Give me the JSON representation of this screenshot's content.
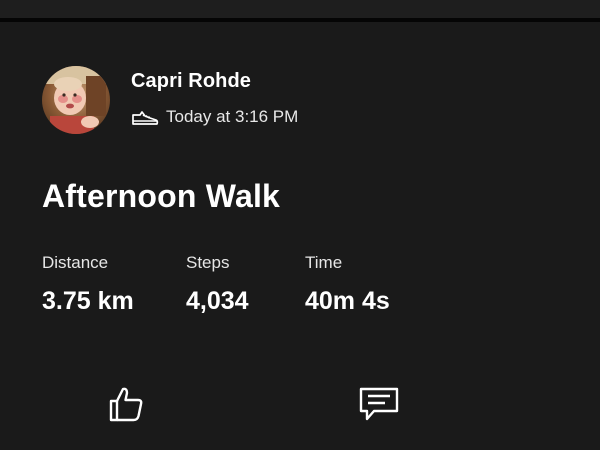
{
  "athlete": {
    "name": "Capri Rohde"
  },
  "activity": {
    "sport_icon": "shoe-icon",
    "timestamp": "Today at 3:16 PM",
    "title": "Afternoon Walk"
  },
  "stats": {
    "distance_label": "Distance",
    "distance_value": "3.75 km",
    "steps_label": "Steps",
    "steps_value": "4,034",
    "time_label": "Time",
    "time_value": "40m 4s"
  },
  "actions": {
    "kudos_icon": "thumbs-up-icon",
    "comment_icon": "comment-icon"
  },
  "colors": {
    "background": "#1a1a1a",
    "text_primary": "#ffffff",
    "divider": "#050505"
  }
}
